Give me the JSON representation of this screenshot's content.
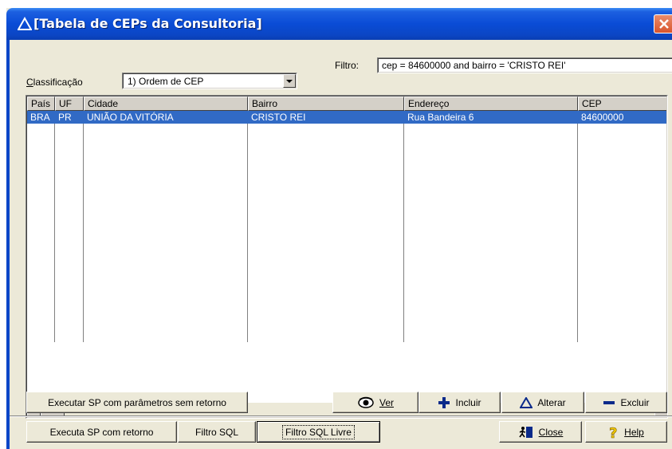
{
  "window": {
    "title": "[Tabela de CEPs da Consultoria]"
  },
  "filter": {
    "label": "Filtro:",
    "value": "cep = 84600000 and bairro = 'CRISTO REI'"
  },
  "classification": {
    "label": "Classificação",
    "selected": "1) Ordem de CEP"
  },
  "grid": {
    "columns": [
      "País",
      "UF",
      "Cidade",
      "Bairro",
      "Endereço",
      "CEP"
    ],
    "rows": [
      {
        "pais": "BRA",
        "uf": "PR",
        "cidade": "UNIÃO DA VITÓRIA",
        "bairro": "CRISTO REI",
        "endereco": "Rua Bandeira 6",
        "cep": "84600000"
      }
    ]
  },
  "buttons": {
    "exec_sp_sem_retorno": "Executar SP com parâmetros sem retorno",
    "ver": "Ver",
    "incluir": "Incluir",
    "alterar": "Alterar",
    "excluir": "Excluir",
    "exec_sp_com_retorno": "Executa SP com retorno",
    "filtro_sql": "Filtro SQL",
    "filtro_sql_livre": "Filtro SQL Livre",
    "close": "Close",
    "help": "Help"
  },
  "colors": {
    "selection": "#316ac5",
    "titlebar": "#0a4cd6",
    "face": "#ece9d8"
  }
}
